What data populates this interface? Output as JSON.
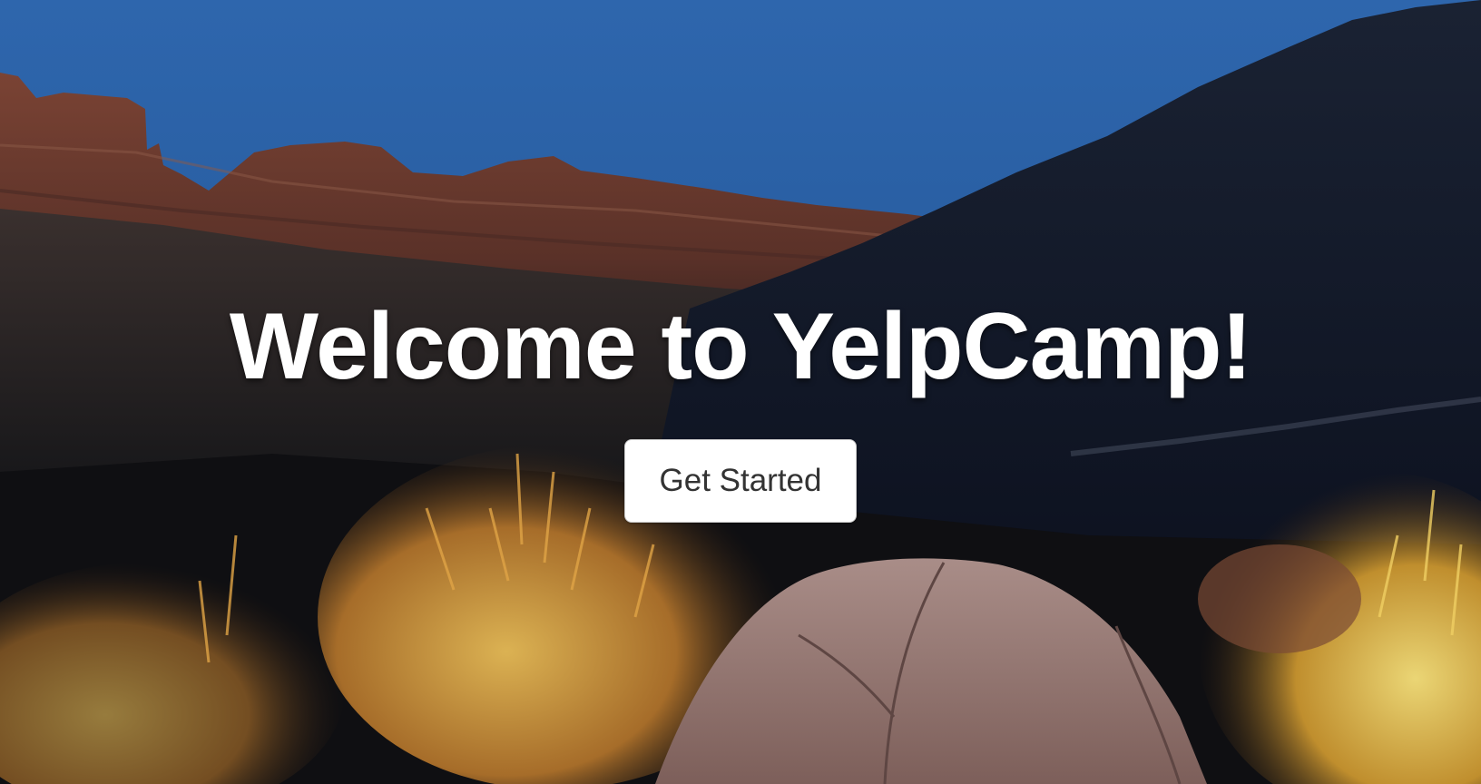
{
  "landing": {
    "title": "Welcome to YelpCamp!",
    "cta_label": "Get Started"
  },
  "background": {
    "scene": "desert-canyon-campsite-photo",
    "colors": {
      "sky": "#2d64a8",
      "cliff": "#6b3a2e",
      "shadow_hill": "#121a2c",
      "brush": "#d9a23a",
      "tent": "#9a7d78"
    }
  },
  "cta_colors": {
    "background": "#ffffff",
    "text": "#333333",
    "border": "#c9c9c9"
  }
}
